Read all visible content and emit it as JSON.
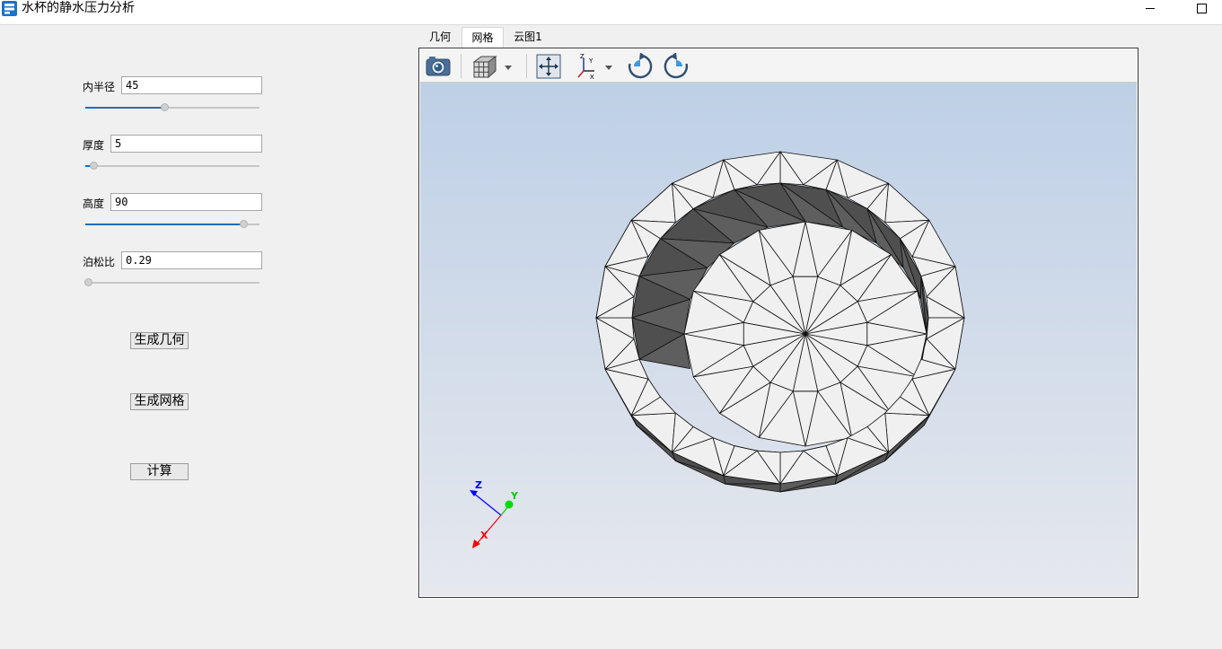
{
  "window": {
    "title": "水杯的静水压力分析",
    "app_icon": "app-icon",
    "controls": [
      "minimize-icon",
      "maximize-icon"
    ]
  },
  "params": {
    "inner_radius": {
      "label": "内半径",
      "value": "45",
      "slider_fraction": 0.45
    },
    "thickness": {
      "label": "厚度",
      "value": "5",
      "slider_fraction": 0.03
    },
    "height": {
      "label": "高度",
      "value": "90",
      "slider_fraction": 0.92
    },
    "poisson": {
      "label": "泊松比",
      "value": "0.29",
      "slider_fraction": 0.0
    }
  },
  "buttons": {
    "gen_geometry": "生成几何",
    "gen_mesh": "生成网格",
    "compute": "计算"
  },
  "tabs": [
    {
      "label": "几何",
      "active": false
    },
    {
      "label": "网格",
      "active": true
    },
    {
      "label": "云图1",
      "active": false
    }
  ],
  "toolbar": [
    "camera-icon",
    "cube-view-icon",
    "fit-view-icon",
    "axes-orient-icon",
    "rotate-cw-icon",
    "rotate-ccw-icon"
  ],
  "axes": {
    "x": "X",
    "y": "Y",
    "z": "Z"
  },
  "colors": {
    "slider_fill": "#1c6dbf",
    "viewport_top": "#bed0e6",
    "viewport_bottom": "#e6e8ee",
    "mesh_light": "#f0f0f0",
    "mesh_dark": "#5a5a5a",
    "axis_x": "#ff0000",
    "axis_y": "#00cc00",
    "axis_z": "#0000ff"
  }
}
